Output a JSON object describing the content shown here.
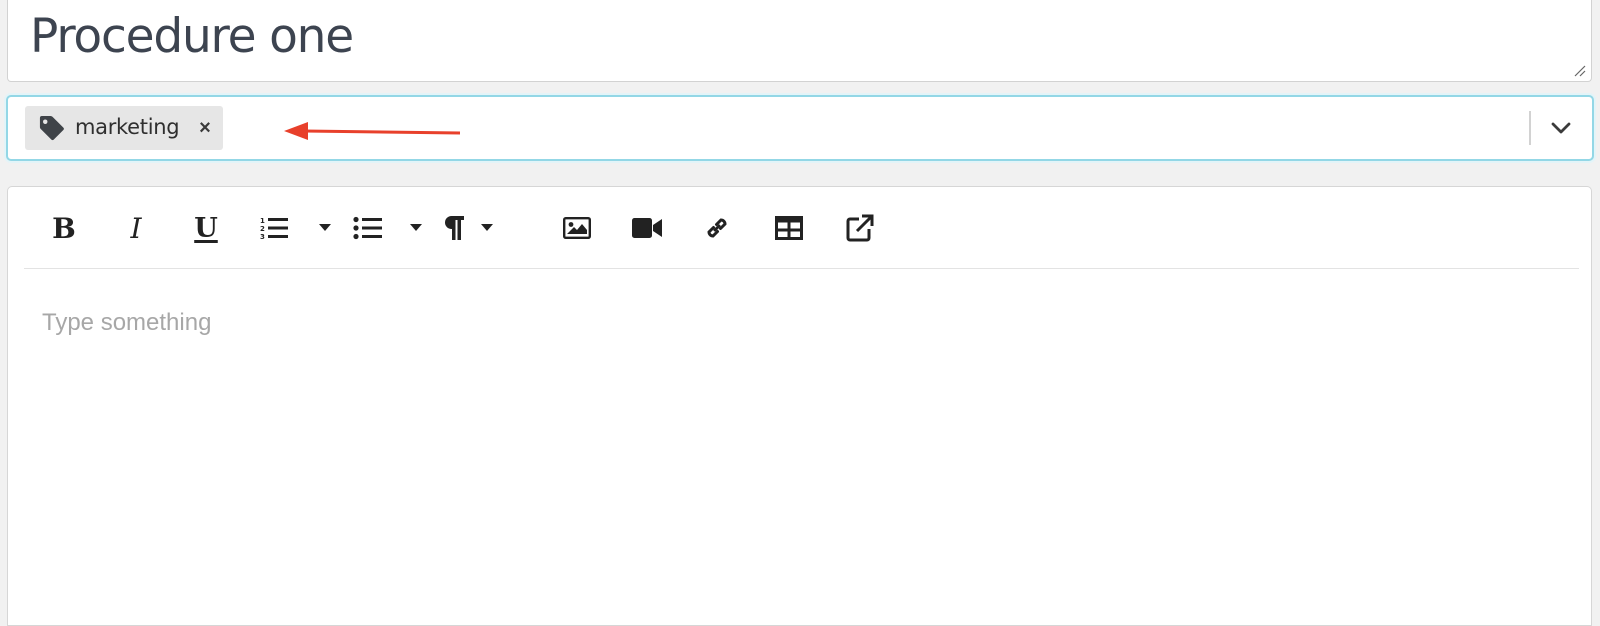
{
  "title": {
    "value": "Procedure one"
  },
  "tags": {
    "items": [
      {
        "label": "marketing",
        "icon": "tag-icon",
        "remove_label": "×"
      }
    ],
    "dropdown_icon": "chevron-down-icon",
    "focus_color": "#93d7e6"
  },
  "annotation": {
    "type": "arrow",
    "color": "#e8402b",
    "points_to": "tag-chip"
  },
  "editor": {
    "toolbar": {
      "bold_label": "B",
      "italic_label": "I",
      "underline_label": "U",
      "buttons": [
        "bold-icon",
        "italic-icon",
        "underline-icon",
        "ordered-list-icon",
        "unordered-list-icon",
        "paragraph-icon",
        "image-icon",
        "video-icon",
        "link-icon",
        "table-icon",
        "external-link-icon"
      ]
    },
    "placeholder": "Type something"
  }
}
